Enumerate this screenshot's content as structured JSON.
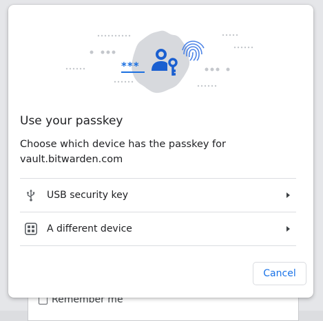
{
  "background": {
    "remember_label": "Remember me"
  },
  "dialog": {
    "title": "Use your passkey",
    "description": "Choose which device has the passkey for vault.bitwarden.com",
    "options": [
      {
        "label": "USB security key",
        "icon": "usb-icon"
      },
      {
        "label": "A different device",
        "icon": "qr-code-icon"
      }
    ],
    "cancel_label": "Cancel",
    "illustration_password_mask": "***"
  },
  "colors": {
    "accent": "#1a73e8",
    "illustration_blob": "#d7d9dd",
    "illustration_blue": "#1a6fe0"
  }
}
